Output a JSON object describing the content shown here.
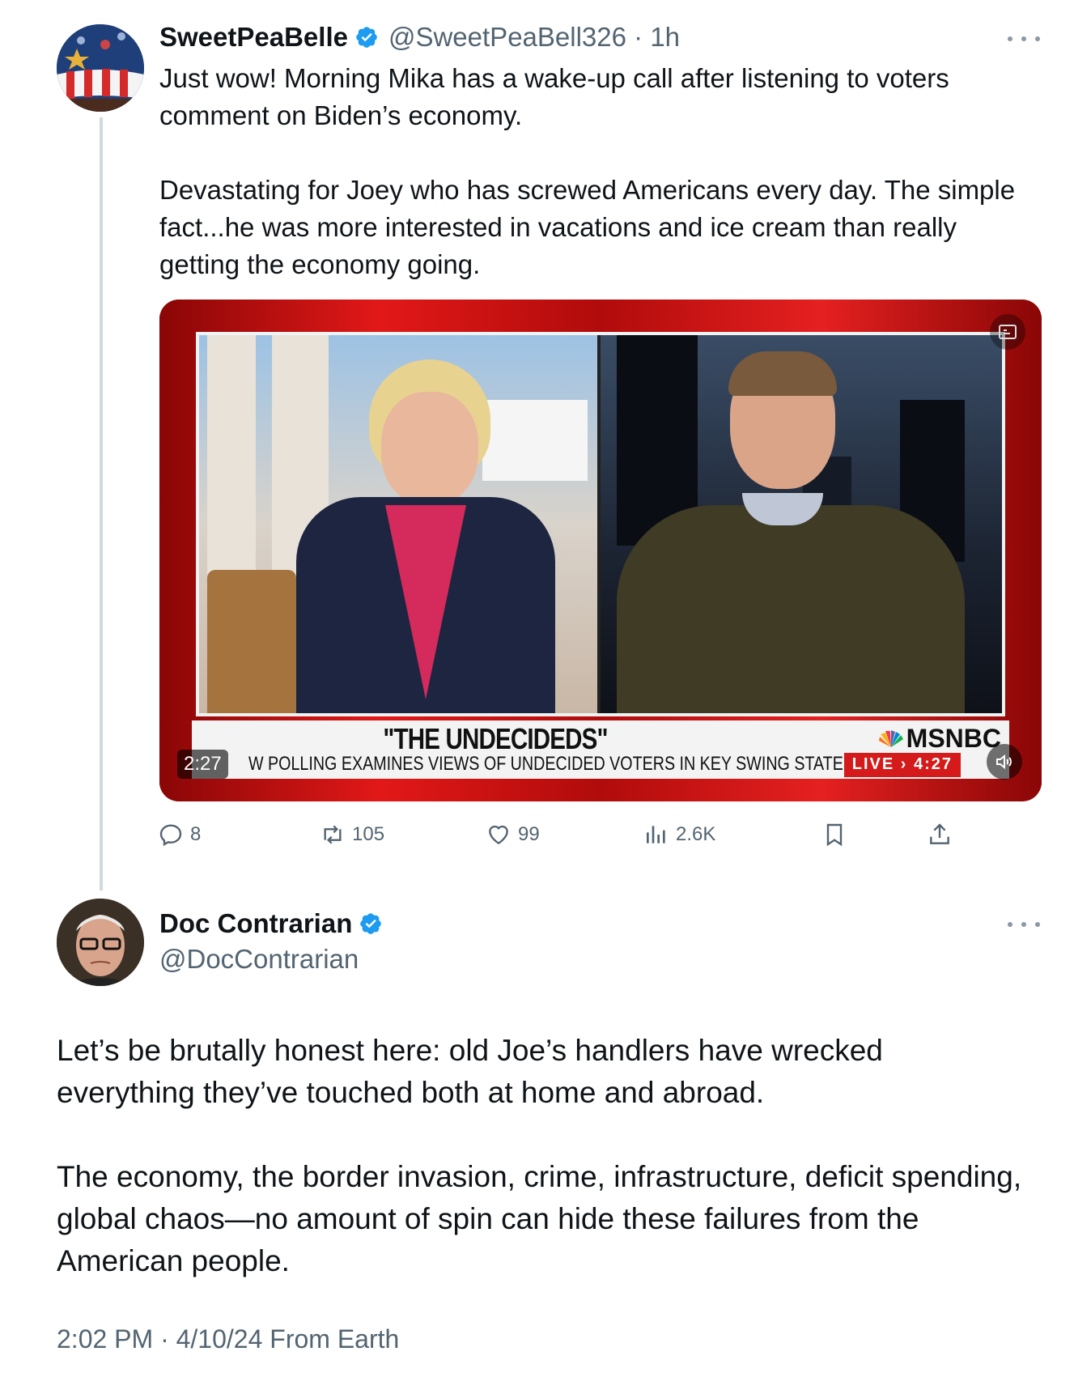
{
  "tweet1": {
    "author_name": "SweetPeaBelle",
    "author_handle": "@SweetPeaBell326",
    "time": "· 1h",
    "paragraphs": [
      "Just wow! Morning Mika has a wake-up call after listening to voters comment on Biden’s economy.",
      "Devastating for Joey  who has screwed Americans every day. The simple fact...he was more interested in vacations and ice cream than really getting the economy going."
    ],
    "video": {
      "lower_third_title": "\"THE UNDECIDEDS\"",
      "lower_third_sub": "W POLLING EXAMINES VIEWS OF UNDECIDED VOTERS IN KEY SWING STATES",
      "network": "MSNBC",
      "live_label": "LIVE › 4:27",
      "duration": "2:27"
    },
    "actions": {
      "replies": "8",
      "reposts": "105",
      "likes": "99",
      "views": "2.6K"
    }
  },
  "tweet2": {
    "author_name": "Doc Contrarian",
    "author_handle": "@DocContrarian",
    "paragraphs": [
      "Let’s be brutally honest here: old Joe’s handlers have wrecked everything they’ve touched both at home and abroad.",
      "The economy, the border invasion, crime, infrastructure, deficit spending, global chaos—no amount of spin can hide these failures from the American people."
    ],
    "meta": "2:02 PM · 4/10/24 From Earth"
  },
  "colors": {
    "verified": "#1d9bf0",
    "secondary_text": "#536471",
    "thread_line": "#cfd9de"
  }
}
